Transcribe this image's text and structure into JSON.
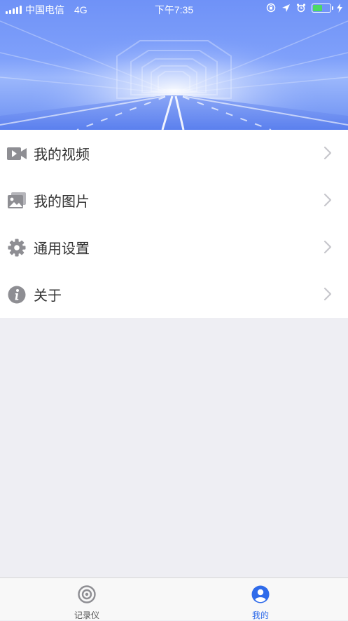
{
  "status_bar": {
    "carrier": "中国电信",
    "network": "4G",
    "time": "下午7:35"
  },
  "menu": {
    "items": [
      {
        "label": "我的视频",
        "icon": "video-camera-icon"
      },
      {
        "label": "我的图片",
        "icon": "photo-icon"
      },
      {
        "label": "通用设置",
        "icon": "gear-icon"
      },
      {
        "label": "关于",
        "icon": "info-icon"
      }
    ]
  },
  "tabbar": {
    "tabs": [
      {
        "label": "记录仪",
        "icon": "recorder-icon",
        "active": false
      },
      {
        "label": "我的",
        "icon": "user-icon",
        "active": true
      }
    ],
    "active_color": "#2F6BEA",
    "inactive_color": "#555555"
  },
  "colors": {
    "icon_gray": "#8E8E93",
    "chevron": "#C7C7CC",
    "background": "#EEEEF3"
  }
}
